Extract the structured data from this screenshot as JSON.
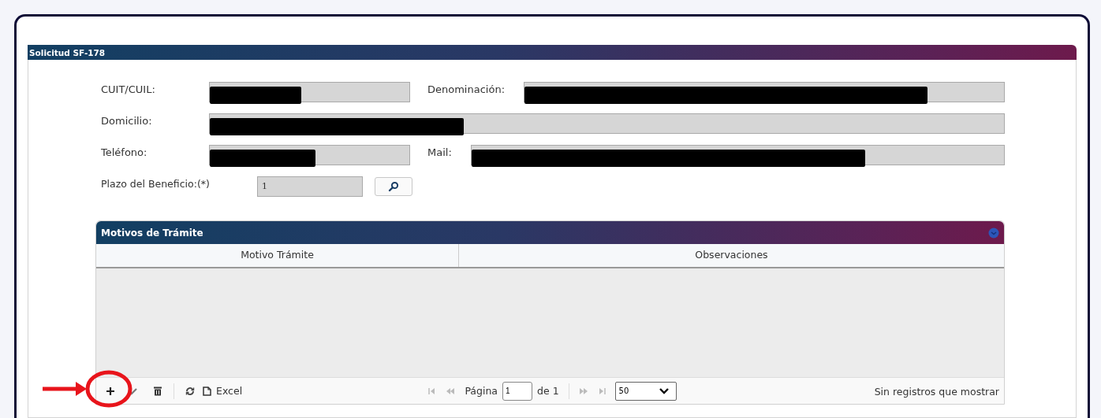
{
  "panel": {
    "title": "Solicitud SF-178"
  },
  "form_rows": [
    {
      "fields": [
        {
          "label": "CUIT/CUIL:",
          "kind": "short",
          "redacted": true
        },
        {
          "label": "Denominación:",
          "kind": "wide",
          "redacted": true
        }
      ]
    },
    {
      "fields": [
        {
          "label": "Domicilio:",
          "kind": "wide",
          "redacted": true
        }
      ]
    },
    {
      "fields": [
        {
          "label": "Teléfono:",
          "kind": "short",
          "redacted": true
        },
        {
          "label": "Mail:",
          "kind": "wide",
          "redacted": true
        }
      ]
    },
    {
      "fields": [
        {
          "label": "Plazo del Beneficio:(*)",
          "kind": "lookup",
          "value": "1",
          "redacted": false
        }
      ]
    }
  ],
  "grid": {
    "title": "Motivos de Trámite",
    "columns": [
      "Motivo Trámite",
      "Observaciones"
    ],
    "pager": {
      "excel": "Excel",
      "page_label": "Página",
      "page": "1",
      "of": "de 1",
      "page_size": "50",
      "status": "Sin registros que mostrar"
    }
  },
  "annotation": {
    "kind": "arrow-circle"
  }
}
